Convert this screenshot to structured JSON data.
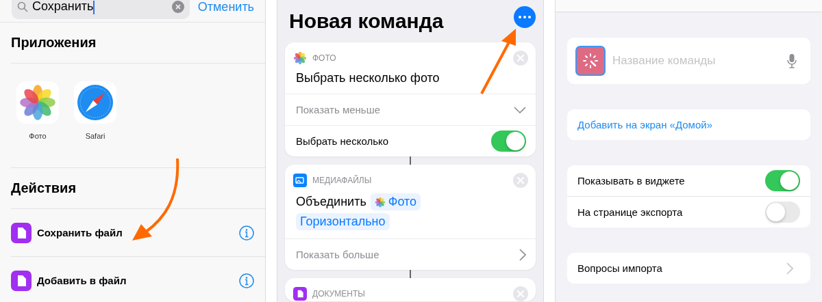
{
  "search": {
    "value": "Сохранить",
    "cancel": "Отменить"
  },
  "apps_section": {
    "title": "Приложения",
    "apps": [
      {
        "kind": "photos",
        "label": "Фото"
      },
      {
        "kind": "safari",
        "label": "Safari"
      }
    ]
  },
  "actions_section": {
    "title": "Действия",
    "actions": [
      {
        "label": "Сохранить файл"
      },
      {
        "label": "Добавить в файл"
      }
    ]
  },
  "editor": {
    "title": "Новая команда",
    "actions": [
      {
        "kind": "photos",
        "category": "ФОТО",
        "title": [
          {
            "kind": "text",
            "text": "Выбрать несколько фото"
          }
        ],
        "toggle_text": "Показать меньше",
        "expanded": true,
        "params": [
          {
            "label": "Выбрать несколько",
            "on": true
          }
        ]
      },
      {
        "kind": "media",
        "category": "МЕДИАФАЙЛЫ",
        "title": [
          {
            "kind": "text",
            "text": "Объединить"
          },
          {
            "kind": "photo_token",
            "text": "Фото"
          },
          {
            "kind": "token",
            "text": "Горизонтально"
          }
        ],
        "toggle_text": "Показать больше",
        "expanded": false
      },
      {
        "kind": "documents",
        "category": "ДОКУМЕНТЫ"
      }
    ]
  },
  "details": {
    "name_placeholder": "Название команды",
    "add_home": "Добавить на экран «Домой»",
    "switches": [
      {
        "label": "Показывать в виджете",
        "on": true
      },
      {
        "label": "На странице экспорта",
        "on": false
      }
    ],
    "import_questions": "Вопросы импорта"
  }
}
